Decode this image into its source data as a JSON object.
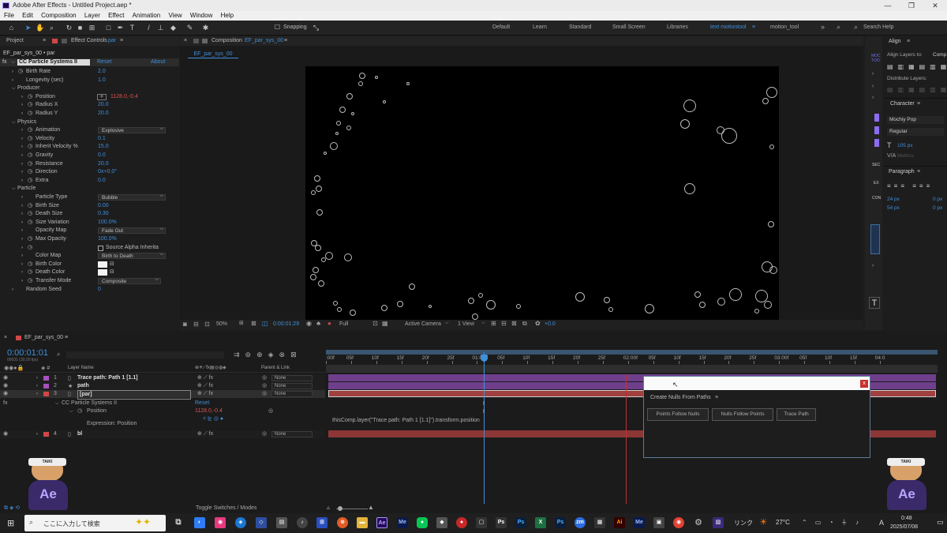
{
  "titlebar": {
    "text": "Adobe After Effects - Untitled Project.aep *",
    "minimize": "—",
    "restore": "❐",
    "close": "✕"
  },
  "menu": [
    "File",
    "Edit",
    "Composition",
    "Layer",
    "Effect",
    "Animation",
    "View",
    "Window",
    "Help"
  ],
  "toolbar": {
    "snapping": "Snapping",
    "workspaces": [
      "Default",
      "Learn",
      "Standard",
      "Small Screen",
      "Libraries",
      "text motiontool",
      "motion_tool"
    ],
    "search_placeholder": "Search Help",
    "more": "»"
  },
  "effect_controls": {
    "tab_project": "Project",
    "tab_effect": "Effect Controls",
    "tab_effect_target": "par",
    "breadcrumb": "EF_par_sys_00 • par",
    "effect_name": "CC Particle Systems II",
    "reset": "Reset",
    "about": "About",
    "rows": [
      {
        "label": "Birth Rate",
        "value": "2.0",
        "indent": 1,
        "stopwatch": true
      },
      {
        "label": "Longevity (sec)",
        "value": "1.0",
        "indent": 1,
        "stopwatch": false
      },
      {
        "label": "Producer",
        "value": "",
        "indent": 1,
        "group": true
      },
      {
        "label": "Position",
        "value": "1128.0,-0.4",
        "indent": 2,
        "stopwatch": true,
        "red": true
      },
      {
        "label": "Radius X",
        "value": "20.0",
        "indent": 2,
        "stopwatch": true
      },
      {
        "label": "Radius Y",
        "value": "20.0",
        "indent": 2,
        "stopwatch": true
      },
      {
        "label": "Physics",
        "value": "",
        "indent": 1,
        "group": true
      },
      {
        "label": "Animation",
        "value": "",
        "indent": 2,
        "stopwatch": true,
        "dropdown": "Explosive"
      },
      {
        "label": "Velocity",
        "value": "0.1",
        "indent": 2,
        "stopwatch": true
      },
      {
        "label": "Inherit Velocity %",
        "value": "15.0",
        "indent": 2,
        "stopwatch": true
      },
      {
        "label": "Gravity",
        "value": "0.0",
        "indent": 2,
        "stopwatch": true
      },
      {
        "label": "Resistance",
        "value": "20.0",
        "indent": 2,
        "stopwatch": true
      },
      {
        "label": "Direction",
        "value": "0x+0.0°",
        "indent": 2,
        "stopwatch": true
      },
      {
        "label": "Extra",
        "value": "0.0",
        "indent": 2,
        "stopwatch": true
      },
      {
        "label": "Particle",
        "value": "",
        "indent": 1,
        "group": true
      },
      {
        "label": "Particle Type",
        "value": "",
        "indent": 2,
        "stopwatch": false,
        "dropdown": "Bubble"
      },
      {
        "label": "Birth Size",
        "value": "0.00",
        "indent": 2,
        "stopwatch": true
      },
      {
        "label": "Death Size",
        "value": "0.30",
        "indent": 2,
        "stopwatch": true
      },
      {
        "label": "Size Variation",
        "value": "100.0%",
        "indent": 2,
        "stopwatch": true
      },
      {
        "label": "Opacity Map",
        "value": "",
        "indent": 2,
        "stopwatch": false,
        "dropdown": "Fade Out"
      },
      {
        "label": "Max Opacity",
        "value": "100.0%",
        "indent": 2,
        "stopwatch": true
      },
      {
        "label": "",
        "value": "",
        "indent": 2,
        "stopwatch": true,
        "checkbox": "Source Alpha Inherita"
      },
      {
        "label": "Color Map",
        "value": "",
        "indent": 2,
        "stopwatch": false,
        "dropdown": "Birth to Death"
      },
      {
        "label": "Birth Color",
        "value": "",
        "indent": 2,
        "stopwatch": true,
        "swatch": true
      },
      {
        "label": "Death Color",
        "value": "",
        "indent": 2,
        "stopwatch": true,
        "swatch": true
      },
      {
        "label": "Transfer Mode",
        "value": "",
        "indent": 2,
        "stopwatch": true,
        "dropdown": "Composite"
      },
      {
        "label": "Random Seed",
        "value": "0",
        "indent": 1,
        "stopwatch": false
      }
    ]
  },
  "composition": {
    "tab": "Composition",
    "tab_target": "EF_par_sys_00",
    "subtab": "EF_par_sys_00",
    "zoom": "50%",
    "timecode": "0:00:01:29",
    "resolution": "Full",
    "camera": "Active Camera",
    "views": "1 View",
    "exposure": "+0.0"
  },
  "right_panel": {
    "align_title": "Align",
    "align_to": "Align Layers to:",
    "align_to_value": "Comp",
    "distribute": "Distribute Layers:",
    "character_title": "Character",
    "font": "Mochiy Pop",
    "style": "Regular",
    "size": "105 px",
    "metrics": "Metrics",
    "paragraph_title": "Paragraph",
    "indent1": "24 px",
    "indent2": "54 px",
    "space1": "0 px",
    "space2": "0 px",
    "side_labels": [
      "MOC",
      "TOO",
      "SEC",
      "EX",
      "CON"
    ]
  },
  "timeline": {
    "tab": "EF_par_sys_00",
    "timecode": "0:00:01:01",
    "frames": "00031 (30.00 fps)",
    "col_layer": "Layer Name",
    "col_parent": "Parent & Link",
    "ticks": [
      ":00f",
      "05f",
      "10f",
      "15f",
      "20f",
      "25f",
      "01:00f",
      "05f",
      "10f",
      "15f",
      "20f",
      "25f",
      "02:00f",
      "05f",
      "10f",
      "15f",
      "20f",
      "25f",
      "03:00f",
      "05f",
      "10f",
      "15f",
      "04:0"
    ],
    "layers": [
      {
        "num": "1",
        "name": "Trace path: Path 1 [1.1]",
        "color": "#a94fbf",
        "parent": "None",
        "kind": "null"
      },
      {
        "num": "2",
        "name": "path",
        "color": "#a94fbf",
        "parent": "None",
        "kind": "star"
      },
      {
        "num": "3",
        "name": "[par]",
        "color": "#d14747",
        "parent": "None",
        "kind": "solid"
      },
      {
        "num": "4",
        "name": "bl",
        "color": "#d14747",
        "parent": "None",
        "kind": "solid"
      }
    ],
    "sub_effect": "CC Particle Systems II",
    "sub_reset": "Reset",
    "sub_prop": "Position",
    "sub_prop_value": "1128.0,-0.4",
    "expression_label": "Expression: Position",
    "expression": "thisComp.layer(\"Trace path: Path 1 [1.1]\").transform.position",
    "toggle": "Toggle Switches / Modes"
  },
  "dialog": {
    "title": "Create Nulls From Paths",
    "buttons": [
      "Points Follow Nulls",
      "Nulls Follow Points",
      "Trace Path"
    ],
    "close": "x"
  },
  "mascot": {
    "text": "Ae",
    "band": "TAIKI"
  },
  "taskbar": {
    "search": "ここに入力して検索",
    "weather": "27°C",
    "time": "0:48",
    "date": "2025/07/08",
    "lang": "A",
    "kana": "リンク"
  }
}
